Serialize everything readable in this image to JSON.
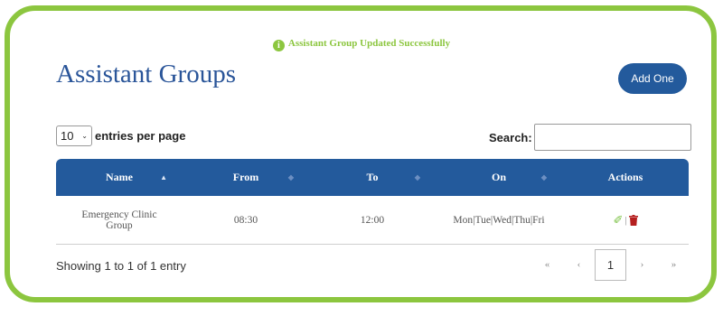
{
  "alert": {
    "icon": "info-icon",
    "message": "Assistant Group Updated Successfully"
  },
  "page": {
    "title": "Assistant Groups",
    "add_button_label": "Add One"
  },
  "entries": {
    "value": "10",
    "label": "entries per page"
  },
  "search": {
    "label": "Search:",
    "value": "",
    "placeholder": ""
  },
  "table": {
    "columns": [
      "Name",
      "From",
      "To",
      "On",
      "Actions"
    ],
    "rows": [
      {
        "name": "Emergency Clinic Group",
        "from": "08:30",
        "to": "12:00",
        "on": "Mon|Tue|Wed|Thu|Fri",
        "actions": [
          "edit-icon",
          "trash-icon"
        ]
      }
    ],
    "action_separator": "|"
  },
  "footer": {
    "info": "Showing 1 to 1 of 1 entry",
    "pagination": {
      "first": "«",
      "prev": "‹",
      "current": "1",
      "next": "›",
      "last": "»"
    }
  },
  "colors": {
    "accent_green": "#8cc63f",
    "header_blue": "#235a9c",
    "title_blue": "#2a5599",
    "trash_red": "#b51f1f"
  }
}
